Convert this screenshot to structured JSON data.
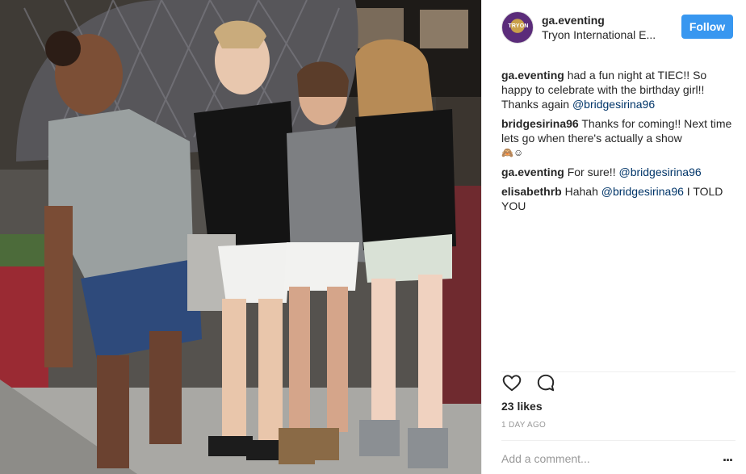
{
  "post": {
    "photo": {
      "alt": "Photo"
    },
    "header": {
      "avatar_text": "TRYON",
      "username": "ga.eventing",
      "location": "Tryon International E...",
      "follow_label": "Follow"
    },
    "comments": [
      {
        "author": "ga.eventing",
        "text_parts": [
          "had a fun night at TIEC!! So happy to celebrate with the birthday girl!! Thanks again "
        ],
        "mention": "@bridgesirina96"
      },
      {
        "author": "bridgesirina96",
        "text": "Thanks for coming!! Next time lets go when there's actually a show",
        "emoji": "🙈☺"
      },
      {
        "author": "ga.eventing",
        "text": "For sure!!",
        "mention": "@bridgesirina96"
      },
      {
        "author": "elisabethrb",
        "text": "Hahah",
        "mention": "@bridgesirina96",
        "text_after": "I TOLD YOU"
      }
    ],
    "actions": {
      "like_icon": "heart-icon",
      "comment_icon": "comment-icon",
      "likes": "23 likes",
      "time": "1 DAY AGO"
    },
    "add_comment": {
      "placeholder": "Add a comment...",
      "more_label": "..."
    }
  },
  "colors": {
    "follow": "#3897f0",
    "mention": "#003569",
    "muted": "#999999",
    "text": "#262626"
  }
}
